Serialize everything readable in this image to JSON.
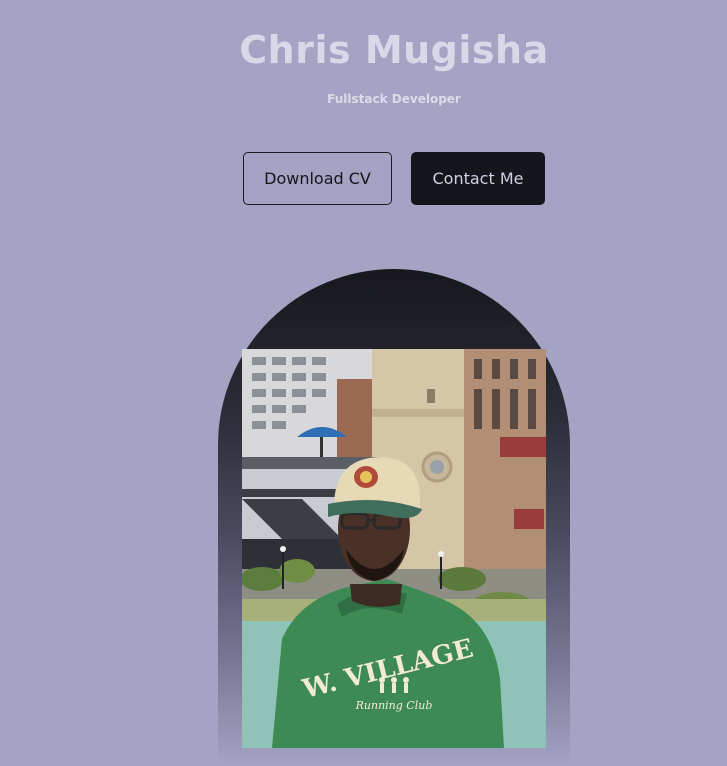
{
  "hero": {
    "name": "Chris Mugisha",
    "title": "Fullstack Developer"
  },
  "actions": {
    "download_cv": "Download CV",
    "contact_me": "Contact Me"
  },
  "portrait": {
    "alt": "Chris Mugisha portrait",
    "sweatshirt_text": "W. VILLAGE",
    "sweatshirt_subtext": "Running Club"
  },
  "colors": {
    "background": "#a4a3c4",
    "accent_dark": "#15161c",
    "heading": "#d9d8e8"
  }
}
